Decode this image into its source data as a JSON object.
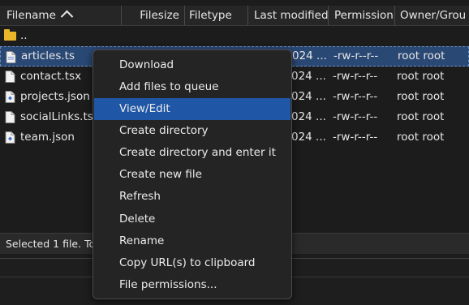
{
  "columns": {
    "filename": "Filename",
    "filesize": "Filesize",
    "filetype": "Filetype",
    "last_modified": "Last modified",
    "permissions": "Permission",
    "owner_group": "Owner/Grou"
  },
  "rows": [
    {
      "name": "..",
      "modified": "",
      "permissions": "",
      "owner": "",
      "icon": "folder-icon"
    },
    {
      "name": "articles.ts",
      "modified": "024 ...",
      "permissions": "-rw-r--r--",
      "owner": "root root",
      "icon": "file-icon"
    },
    {
      "name": "contact.tsx",
      "modified": "024 ...",
      "permissions": "-rw-r--r--",
      "owner": "root root",
      "icon": "file-icon"
    },
    {
      "name": "projects.json",
      "modified": "024 ...",
      "permissions": "-rw-r--r--",
      "owner": "root root",
      "icon": "json-file-icon"
    },
    {
      "name": "socialLinks.ts",
      "modified": "024 ...",
      "permissions": "-rw-r--r--",
      "owner": "root root",
      "icon": "file-icon"
    },
    {
      "name": "team.json",
      "modified": "024 ...",
      "permissions": "-rw-r--r--",
      "owner": "root root",
      "icon": "json-file-icon"
    }
  ],
  "status": "Selected 1 file. To",
  "context_menu": [
    "Download",
    "Add files to queue",
    "View/Edit",
    "Create directory",
    "Create directory and enter it",
    "Create new file",
    "Refresh",
    "Delete",
    "Rename",
    "Copy URL(s) to clipboard",
    "File permissions..."
  ],
  "highlighted_menu_item": "View/Edit",
  "colors": {
    "selection": "#2a4874",
    "menu_highlight": "#1f56a6",
    "folder": "#e8b52b"
  }
}
